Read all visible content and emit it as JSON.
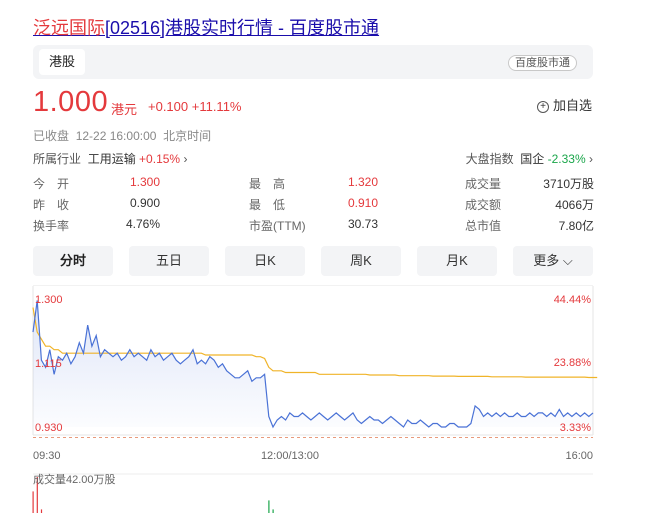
{
  "header": {
    "title_highlight": "泛远国际",
    "title_rest": "[02516]港股实时行情 - 百度股市通"
  },
  "tabs": {
    "active": "港股",
    "source": "百度股市通"
  },
  "quote": {
    "price": "1.000",
    "currency": "港元",
    "change": "+0.100 +11.11%",
    "watch_label": "加自选",
    "status": "已收盘",
    "time": "12-22 16:00:00",
    "timezone": "北京时间"
  },
  "industry": {
    "label": "所属行业",
    "name": "工用运输",
    "change": "+0.15%"
  },
  "index": {
    "label": "大盘指数",
    "name": "国企",
    "change": "-2.33%"
  },
  "stats": {
    "open_label": "今　开",
    "open": "1.300",
    "prev_label": "昨　收",
    "prev": "0.900",
    "turnover_label": "换手率",
    "turnover": "4.76%",
    "high_label": "最　高",
    "high": "1.320",
    "low_label": "最　低",
    "low": "0.910",
    "pe_label": "市盈(TTM)",
    "pe": "30.73",
    "volume_label": "成交量",
    "volume": "3710万股",
    "amount_label": "成交额",
    "amount": "4066万",
    "mcap_label": "总市值",
    "mcap": "7.80亿"
  },
  "periods": [
    "分时",
    "五日",
    "日K",
    "周K",
    "月K",
    "更多"
  ],
  "colors": {
    "up": "#e4393c",
    "down": "#1aa64a",
    "link": "#1a0dab",
    "price_line": "#4a72d6",
    "avg_line": "#f0b429"
  },
  "chart_data": {
    "type": "line",
    "y_ticks_left": [
      "1.300",
      "1.115",
      "0.930"
    ],
    "y_ticks_right": [
      "44.44%",
      "23.88%",
      "3.33%"
    ],
    "x_ticks": [
      "09:30",
      "12:00/13:00",
      "16:00"
    ],
    "ylim": [
      0.93,
      1.3
    ],
    "prev_close": 0.9,
    "series": [
      {
        "values": [
          1.2,
          1.29,
          1.12,
          1.1,
          1.15,
          1.08,
          1.13,
          1.12,
          1.14,
          1.11,
          1.13,
          1.17,
          1.14,
          1.22,
          1.16,
          1.19,
          1.13,
          1.15,
          1.14,
          1.13,
          1.14,
          1.12,
          1.13,
          1.15,
          1.13,
          1.14,
          1.13,
          1.12,
          1.15,
          1.13,
          1.14,
          1.12,
          1.13,
          1.14,
          1.12,
          1.11,
          1.12,
          1.13,
          1.15,
          1.11,
          1.12,
          1.11,
          1.13,
          1.12,
          1.1,
          1.11,
          1.09,
          1.08,
          1.07,
          1.07,
          1.08,
          1.09,
          1.06,
          1.07,
          1.07,
          1.08,
          0.96,
          0.93,
          0.95,
          0.96,
          0.95,
          0.97,
          0.96,
          0.96,
          0.97,
          0.96,
          0.95,
          0.96,
          0.97,
          0.96,
          0.95,
          0.96,
          0.97,
          0.96,
          0.95,
          0.96,
          0.97,
          0.95,
          0.94,
          0.95,
          0.96,
          0.95,
          0.95,
          0.94,
          0.95,
          0.96,
          0.95,
          0.94,
          0.93,
          0.95,
          0.94,
          0.94,
          0.95,
          0.94,
          0.93,
          0.94,
          0.94,
          0.93,
          0.93,
          0.94,
          0.94,
          0.93,
          0.93,
          0.93,
          0.94,
          0.99,
          0.98,
          0.96,
          0.97,
          0.96,
          0.97,
          0.96,
          0.97,
          0.96,
          0.96,
          0.97,
          0.96,
          0.96,
          0.97,
          0.96,
          0.97,
          0.97,
          0.96,
          0.97,
          0.96,
          0.98,
          0.96,
          0.97,
          0.96,
          0.97,
          0.96,
          0.97,
          0.96,
          0.97
        ]
      },
      {
        "values": [
          1.27,
          1.2,
          1.18,
          1.16,
          1.16,
          1.15,
          1.15,
          1.14,
          1.14,
          1.14,
          1.14,
          1.14,
          1.14,
          1.14,
          1.14,
          1.14,
          1.14,
          1.14,
          1.14,
          1.14,
          1.14,
          1.14,
          1.14,
          1.14,
          1.14,
          1.14,
          1.14,
          1.14,
          1.14,
          1.14,
          1.14,
          1.14,
          1.14,
          1.14,
          1.14,
          1.14,
          1.14,
          1.14,
          1.14,
          1.14,
          1.14,
          1.135,
          1.135,
          1.135,
          1.135,
          1.135,
          1.135,
          1.135,
          1.135,
          1.135,
          1.135,
          1.135,
          1.135,
          1.13,
          1.13,
          1.125,
          1.1,
          1.09,
          1.09,
          1.09,
          1.085,
          1.085,
          1.085,
          1.085,
          1.085,
          1.085,
          1.085,
          1.085,
          1.08,
          1.08,
          1.08,
          1.08,
          1.08,
          1.08,
          1.08,
          1.08,
          1.08,
          1.08,
          1.08,
          1.08,
          1.078,
          1.078,
          1.078,
          1.078,
          1.078,
          1.078,
          1.078,
          1.076,
          1.076,
          1.076,
          1.076,
          1.076,
          1.076,
          1.076,
          1.076,
          1.075,
          1.075,
          1.075,
          1.075,
          1.075,
          1.075,
          1.074,
          1.074,
          1.074,
          1.074,
          1.074,
          1.074,
          1.074,
          1.074,
          1.073,
          1.073,
          1.073,
          1.073,
          1.073,
          1.073,
          1.073,
          1.073,
          1.072,
          1.072,
          1.072,
          1.072,
          1.072,
          1.072,
          1.072,
          1.072,
          1.072,
          1.072,
          1.072,
          1.072,
          1.072,
          1.072,
          1.072,
          1.071,
          1.071,
          1.071
        ]
      }
    ],
    "volume_label": "成交量42.00万股",
    "volume": [
      0.6,
      1,
      0.1,
      0,
      0,
      0,
      0,
      0,
      0,
      0,
      0,
      0,
      0,
      0,
      0,
      0,
      0,
      0,
      0,
      0,
      0,
      0,
      0,
      0,
      0,
      0,
      0,
      0,
      0,
      0,
      0,
      0,
      0,
      0,
      0,
      0,
      0,
      0,
      0,
      0,
      0,
      0,
      0,
      0,
      0,
      0,
      0,
      0,
      0,
      0,
      0,
      0,
      0,
      0,
      0,
      0,
      0.35,
      0.1,
      0,
      0,
      0,
      0,
      0,
      0,
      0,
      0,
      0,
      0,
      0,
      0,
      0,
      0,
      0,
      0,
      0,
      0,
      0,
      0,
      0,
      0,
      0,
      0,
      0,
      0,
      0,
      0,
      0,
      0,
      0,
      0,
      0,
      0,
      0,
      0,
      0,
      0,
      0,
      0,
      0,
      0,
      0,
      0,
      0,
      0,
      0,
      0,
      0,
      0,
      0,
      0,
      0,
      0,
      0,
      0,
      0,
      0,
      0,
      0,
      0,
      0,
      0,
      0,
      0,
      0,
      0,
      0,
      0,
      0,
      0,
      0,
      0,
      0,
      0,
      0
    ]
  }
}
